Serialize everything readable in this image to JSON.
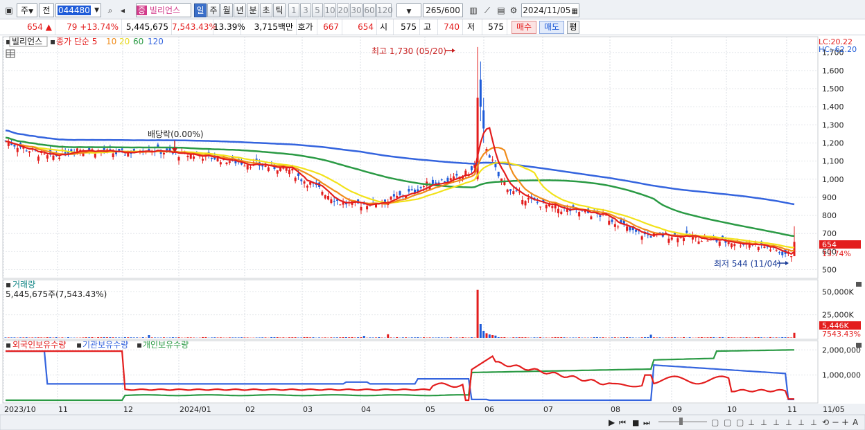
{
  "toolbar": {
    "period_selector": "주",
    "prev_label": "전",
    "stock_code": "044480",
    "stock_name": "빌리언스",
    "stock_badge": "증",
    "period_buttons": [
      "일",
      "주",
      "월",
      "년",
      "분",
      "초",
      "틱"
    ],
    "active_period": "일",
    "interval_buttons": [
      "1",
      "3",
      "5",
      "10",
      "20",
      "30",
      "60",
      "120"
    ],
    "count": "265",
    "count_max": "/600",
    "date": "2024/11/05"
  },
  "quote": {
    "price": "654",
    "change_arrow": "▲",
    "change": "79",
    "change_pct": "+13.74%",
    "volume": "5,445,675",
    "volume_pct": "7,543.43%",
    "turnover": "13.39%",
    "amount": "3,715백만",
    "hoga_label": "호가",
    "ask": "667",
    "bid": "654",
    "open_label": "시",
    "open": "575",
    "high_label": "고",
    "high": "740",
    "low_label": "저",
    "low": "575",
    "buy_label": "매수",
    "sell_label": "매도",
    "eval_label": "평"
  },
  "legend": {
    "name": "빌리언스",
    "main": "종가 단순 5",
    "ma10": "10",
    "ma20": "20",
    "ma60": "60",
    "ma120": "120"
  },
  "annotations": {
    "high": "최고 1,730 (05/20)",
    "low": "최저 544 (11/04)",
    "dividend": "배당락(0.00%)",
    "lc": "LC:20.22",
    "hc": "HC:-62.20",
    "price_tag": "654",
    "pct_tag": "13.74%",
    "vol_tag": "5,446K",
    "vol_pct_tag": "7543.43%"
  },
  "volume_panel": {
    "title": "거래량",
    "value": "5,445,675주(7,543.43%)"
  },
  "holdings_panel": {
    "foreign": "외국인보유수량",
    "institution": "기관보유수량",
    "individual": "개인보유수량"
  },
  "colors": {
    "up": "#e31d1d",
    "down": "#1e5bd8",
    "ma5": "#e31d1d",
    "ma10": "#f08c1a",
    "ma20": "#f2e21a",
    "ma60": "#2a9a44",
    "ma120": "#3464de"
  },
  "chart_data": [
    {
      "type": "candlestick",
      "title": "빌리언스",
      "x_ticks": [
        "2023/10",
        "11",
        "12",
        "2024/01",
        "02",
        "03",
        "04",
        "05",
        "06",
        "07",
        "08",
        "09",
        "10",
        "11",
        "11/05"
      ],
      "y_ticks": [
        500,
        600,
        700,
        800,
        900,
        1000,
        1100,
        1200,
        1300,
        1400,
        1500,
        1600,
        1700
      ],
      "ylim": [
        460,
        1760
      ],
      "series_moving_average": [
        "5",
        "10",
        "20",
        "60",
        "120"
      ],
      "high": {
        "value": 1730,
        "date": "05/20"
      },
      "low": {
        "value": 544,
        "date": "11/04"
      },
      "last_close": 654,
      "points": [
        {
          "date": "2023-10",
          "close": 1210
        },
        {
          "date": "2023-11",
          "close": 1150
        },
        {
          "date": "2023-12",
          "close": 1150
        },
        {
          "date": "2024-01",
          "close": 1120
        },
        {
          "date": "2024-02",
          "close": 1080
        },
        {
          "date": "2024-03",
          "close": 1000
        },
        {
          "date": "2024-04",
          "close": 870
        },
        {
          "date": "2024-05",
          "close": 960
        },
        {
          "date": "2024-05-20",
          "close": 1300
        },
        {
          "date": "2024-06",
          "close": 920
        },
        {
          "date": "2024-07",
          "close": 820
        },
        {
          "date": "2024-08",
          "close": 750
        },
        {
          "date": "2024-09",
          "close": 690
        },
        {
          "date": "2024-10",
          "close": 660
        },
        {
          "date": "2024-11-04",
          "close": 575
        },
        {
          "date": "2024-11-05",
          "close": 654
        }
      ]
    },
    {
      "type": "bar",
      "title": "거래량",
      "y_ticks": [
        "25,000K",
        "50,000K"
      ],
      "peak_date": "2024-05-20",
      "last_value": "5,446K"
    },
    {
      "type": "line",
      "title": "보유수량",
      "y_ticks": [
        "1,000,000",
        "2,000,000"
      ],
      "series": [
        {
          "name": "외국인보유수량"
        },
        {
          "name": "기관보유수량"
        },
        {
          "name": "개인보유수량"
        }
      ]
    }
  ]
}
